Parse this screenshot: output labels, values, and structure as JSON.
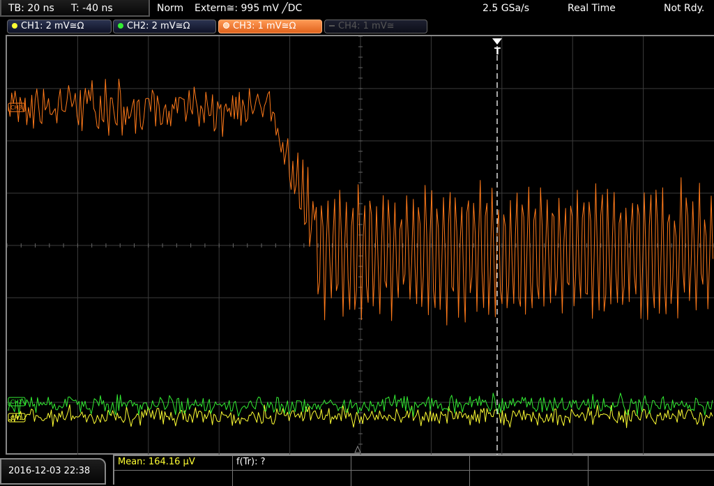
{
  "status_bar": {
    "timebase": "TB: 20 ns",
    "trigger_time": "T: -40 ns",
    "acq_mode": "Norm",
    "trigger_source": "Extern≅: 995 mV ╱DC",
    "sample_rate": "2.5 GSa/s",
    "mode": "Real Time",
    "trigger_state": "Not Rdy."
  },
  "channels": [
    {
      "label": "CH1: 2 mV≅Ω",
      "color": "#ffff33",
      "state": "on"
    },
    {
      "label": "CH2: 2 mV≅Ω",
      "color": "#33ee33",
      "state": "on"
    },
    {
      "label": "CH3: 1 mV≅Ω",
      "color": "#ff7a1a",
      "state": "selected"
    },
    {
      "label": "CH4: 1 mV≅",
      "color": "#555555",
      "state": "off"
    }
  ],
  "screen": {
    "trigger_marker": "T",
    "trace_markers": [
      "CH3",
      "CH2",
      "CH1"
    ]
  },
  "bottom": {
    "datetime": "2016-12-03 22:38",
    "measurement_1": "Mean: 164.16 µV",
    "measurement_2": "f(Tr): ?"
  },
  "colors": {
    "ch1": "#ffff33",
    "ch2": "#33ee33",
    "ch3": "#ff7a1a",
    "grid": "#3c3c3c",
    "measurement_text": "#ffff33"
  }
}
